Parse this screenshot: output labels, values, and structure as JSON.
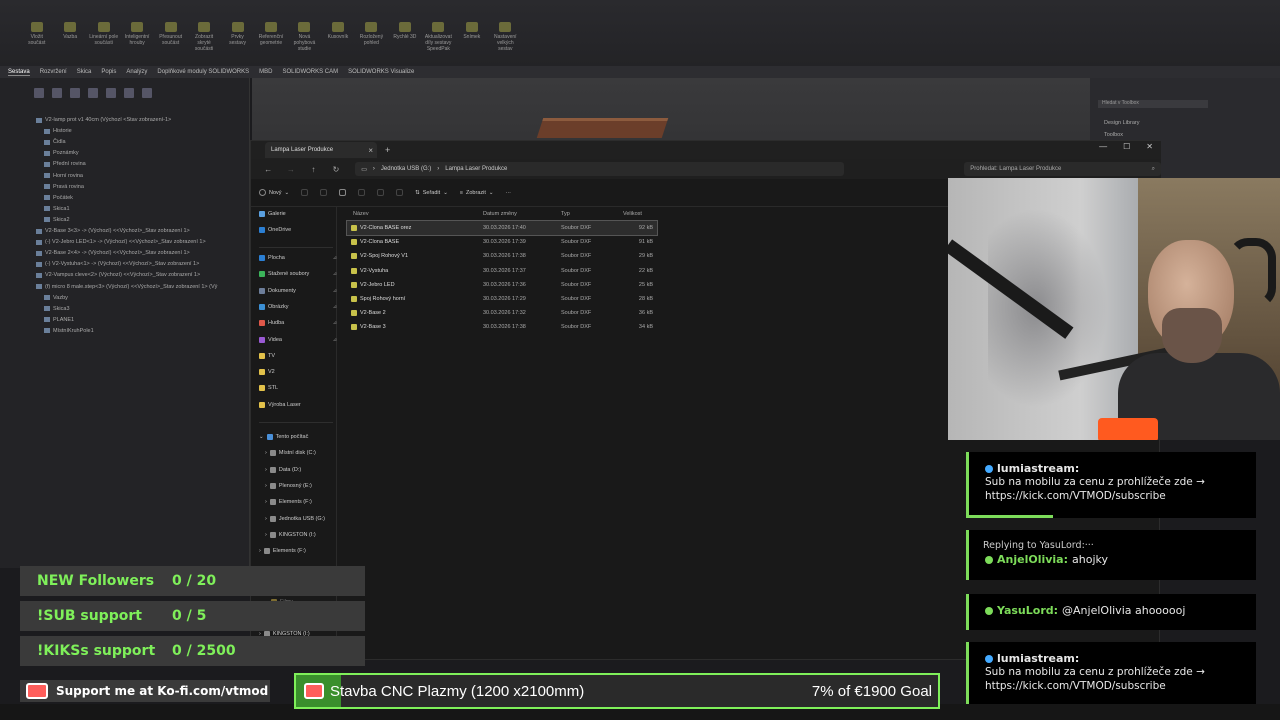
{
  "solidworks": {
    "ribbon_items": [
      "Vložit součást",
      "Vazba",
      "Lineární pole součásti",
      "Inteligentní hrouby",
      "Přesunout součást",
      "Zobrazit skryté součásti",
      "Prvky sestavy",
      "Referenční geometrie",
      "Nová pohybová studie",
      "Kusovník",
      "Rozložený pohled",
      "Rychlé 3D",
      "Aktualizovat díly sestavy SpeedPak",
      "Snímek",
      "Nastavení velkých sestav"
    ],
    "tabs": [
      "Sestava",
      "Rozvržení",
      "Skica",
      "Popis",
      "Analýzy",
      "Doplňkové moduly SOLIDWORKS",
      "MBD",
      "SOLIDWORKS CAM",
      "SOLIDWORKS Visualize"
    ],
    "tree": [
      "V2-lamp prot v1 40cm (Výchozí <Stav zobrazení-1>",
      "Historie",
      "Čidla",
      "Poznámky",
      "Přední rovina",
      "Horní rovina",
      "Pravá rovina",
      "Počátek",
      "Skica1",
      "Skica2",
      "V2-Base 3<3> -> (Výchozí) <<Výchozí>_Stav zobrazení 1>",
      "(-) V2-Jebro LED<1> -> (Výchozí) <<Výchozí>_Stav zobrazení 1>",
      "V2-Base 2<4> -> (Výchozí) <<Výchozí>_Stav zobrazení 1>",
      "(-) V2-Vystuha<1> -> (Výchozí) <<Výchozí>_Stav zobrazení 1>",
      "V2-Vampus cleve<2> (Výchozí) <<Výchozí>_Stav zobrazení 1>",
      "(f) micro 8 male.step<3> (Výchozí) <<Výchozí>_Stav zobrazení 1> (Vý",
      "Vazby",
      "Skica3",
      "PLANE1",
      "MístníKruhPole1"
    ],
    "right_panel": [
      "Hledat v Toolbox",
      "Design Library",
      "Toolbox"
    ]
  },
  "explorer": {
    "tab_title": "Lampa Laser Produkce",
    "address": [
      "Jednotka USB (G:)",
      "Lampa Laser Produkce"
    ],
    "search_placeholder": "Prohledat: Lampa Laser Produkce",
    "commands": {
      "new": "Nový",
      "sort": "Seřadit",
      "view": "Zobrazit"
    },
    "sidebar": {
      "quick": [
        "Galerie",
        "OneDrive"
      ],
      "pinned": [
        "Plocha",
        "Stažené soubory",
        "Dokumenty",
        "Obrázky",
        "Hudba",
        "Videa",
        "TV",
        "V2",
        "STL",
        "Výroba Laser"
      ],
      "this_pc": "Tento počítač",
      "drives": [
        "Místní disk (C:)",
        "Data (D:)",
        "Plenosný (E:)",
        "Elements (F:)",
        "Jednotka USB (G:)",
        "KINGSTON (I:)",
        "Elements (F:)"
      ],
      "extra": [
        "Filmy",
        "KINGSTON (I:)"
      ]
    },
    "columns": {
      "name": "Název",
      "date": "Datum změny",
      "type": "Typ",
      "size": "Velikost"
    },
    "files": [
      {
        "name": "V2-Clona BASE orez",
        "date": "30.03.2026 17:40",
        "type": "Soubor DXF",
        "size": "92 kB"
      },
      {
        "name": "V2-Clona BASE",
        "date": "30.03.2026 17:39",
        "type": "Soubor DXF",
        "size": "91 kB"
      },
      {
        "name": "V2-Spoj Rohový V1",
        "date": "30.03.2026 17:38",
        "type": "Soubor DXF",
        "size": "29 kB"
      },
      {
        "name": "V2-Vystuha",
        "date": "30.03.2026 17:37",
        "type": "Soubor DXF",
        "size": "22 kB"
      },
      {
        "name": "V2-Jebro LED",
        "date": "30.03.2026 17:36",
        "type": "Soubor DXF",
        "size": "25 kB"
      },
      {
        "name": "Spoj Rohový horní",
        "date": "30.03.2026 17:29",
        "type": "Soubor DXF",
        "size": "28 kB"
      },
      {
        "name": "V2-Base 2",
        "date": "30.03.2026 17:32",
        "type": "Soubor DXF",
        "size": "36 kB"
      },
      {
        "name": "V2-Base 3",
        "date": "30.03.2026 17:38",
        "type": "Soubor DXF",
        "size": "34 kB"
      }
    ]
  },
  "chat": [
    {
      "user": "lumiastream:",
      "text": "Sub na mobilu za cenu z prohlížeče zde → https://kick.com/VTMOD/subscribe",
      "color": "#7ddc5a"
    },
    {
      "reply": "Replying to YasuLord:···",
      "user": "AnjelOlivia:",
      "text": "ahojky",
      "color": "#7ddc5a"
    },
    {
      "user": "YasuLord:",
      "text": "@AnjelOlivia ahoooooj",
      "color": "#7ddc5a"
    },
    {
      "user": "lumiastream:",
      "text": "Sub na mobilu za cenu z prohlížeče zde → https://kick.com/VTMOD/subscribe",
      "color": "#7ddc5a"
    }
  ],
  "goals": [
    {
      "label": "NEW Followers",
      "count": "0 / 20",
      "progress": 0
    },
    {
      "label": "!SUB support",
      "count": "0 / 5",
      "progress": 0
    },
    {
      "label": "!KIKSs support",
      "count": "0 / 2500",
      "progress": 0
    }
  ],
  "kofi": {
    "text": "Support me at Ko-fi.com/vtmod"
  },
  "donation": {
    "title": "Stavba CNC Plazmy (1200 x2100mm)",
    "goal": "7% of €1900 Goal",
    "progress": 0.07
  },
  "colors": {
    "accent": "#7ff05a",
    "kofi": "#ff5e5b",
    "mic": "#ff5a1f",
    "folder": "#c8c24a"
  }
}
